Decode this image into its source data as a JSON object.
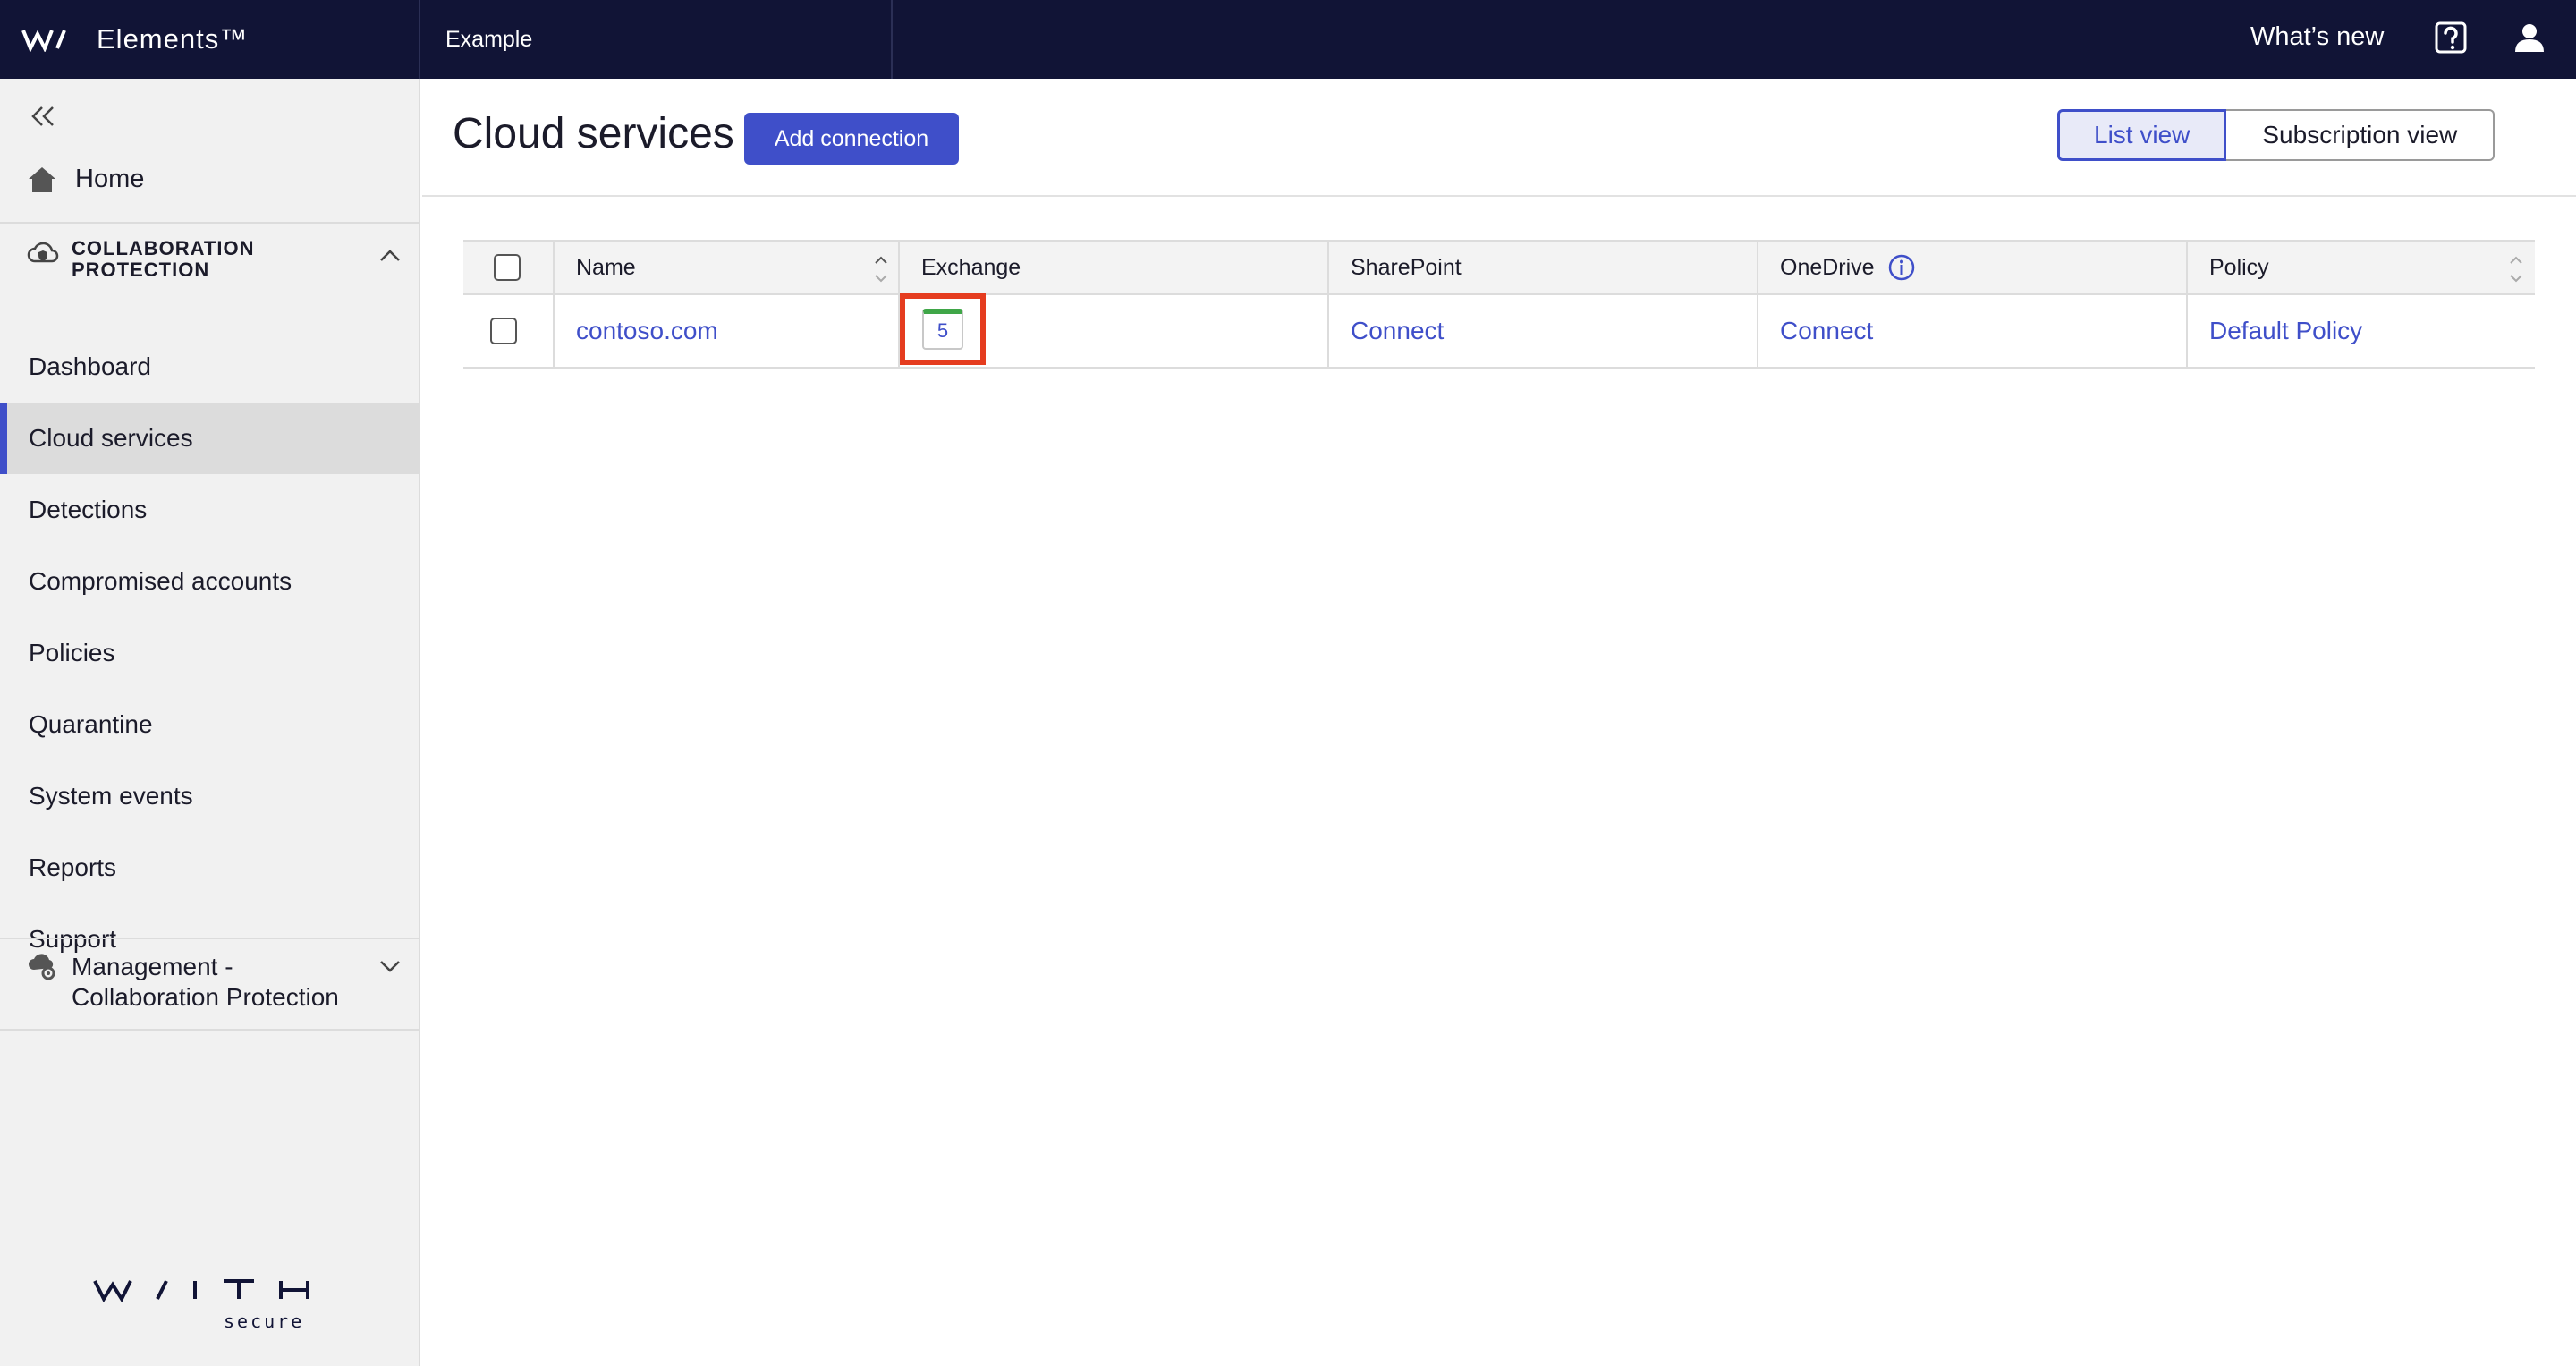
{
  "topbar": {
    "brand_name": "Elements™",
    "tenant": "Example",
    "whats_new": "What’s new"
  },
  "sidebar": {
    "home": "Home",
    "section_title_line1": "COLLABORATION",
    "section_title_line2": "PROTECTION",
    "items": [
      {
        "label": "Dashboard"
      },
      {
        "label": "Cloud services"
      },
      {
        "label": "Detections"
      },
      {
        "label": "Compromised accounts"
      },
      {
        "label": "Policies"
      },
      {
        "label": "Quarantine"
      },
      {
        "label": "System events"
      },
      {
        "label": "Reports"
      },
      {
        "label": "Support"
      }
    ],
    "management_line1": "Management -",
    "management_line2": "Collaboration Protection",
    "logo_text": "WITH secure"
  },
  "main": {
    "title": "Cloud services",
    "add_button": "Add connection",
    "views": [
      "List view",
      "Subscription view"
    ]
  },
  "table": {
    "columns": [
      "Name",
      "Exchange",
      "SharePoint",
      "OneDrive",
      "Policy"
    ],
    "rows": [
      {
        "name": "contoso.com",
        "exchange_count": "5",
        "sharepoint": "Connect",
        "onedrive": "Connect",
        "policy": "Default Policy"
      }
    ]
  },
  "colors": {
    "topbar": "#111436",
    "accent": "#3f4fc9",
    "highlight": "#e53c1f",
    "status_green": "#3fa648"
  }
}
